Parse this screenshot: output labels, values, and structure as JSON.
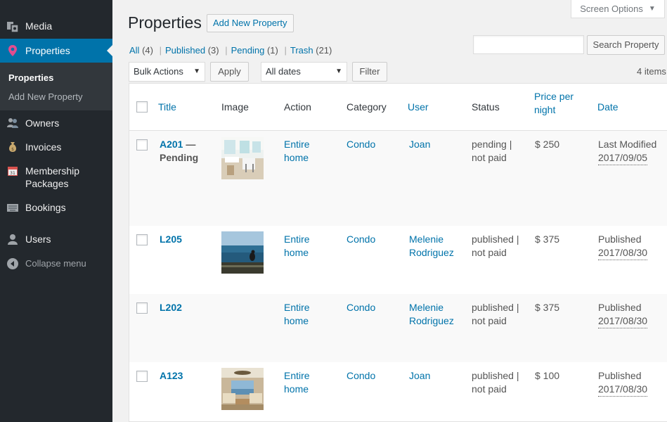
{
  "sidebar": {
    "items": [
      {
        "label": "Media",
        "icon": "media-icon"
      },
      {
        "label": "Properties",
        "icon": "pin-icon",
        "active": true
      },
      {
        "label": "Owners",
        "icon": "owners-icon"
      },
      {
        "label": "Invoices",
        "icon": "money-bag-icon"
      },
      {
        "label": "Membership Packages",
        "icon": "calendar-icon"
      },
      {
        "label": "Bookings",
        "icon": "keyboard-icon"
      },
      {
        "label": "Users",
        "icon": "user-icon"
      }
    ],
    "submenu": [
      "Properties",
      "Add New Property"
    ],
    "collapse": "Collapse menu"
  },
  "header": {
    "screen_options": "Screen Options",
    "title": "Properties",
    "add_new": "Add New Property"
  },
  "views": {
    "all": "All",
    "all_count": "(4)",
    "published": "Published",
    "published_count": "(3)",
    "pending": "Pending",
    "pending_count": "(1)",
    "trash": "Trash",
    "trash_count": "(21)",
    "separator": "|"
  },
  "search": {
    "value": "",
    "button": "Search Property"
  },
  "toolbar": {
    "bulk_actions": "Bulk Actions",
    "apply": "Apply",
    "dates": "All dates",
    "filter": "Filter",
    "items_count": "4 items"
  },
  "table": {
    "columns": [
      "Title",
      "Image",
      "Action",
      "Category",
      "User",
      "Status",
      "Price per night",
      "Date"
    ],
    "rows": [
      {
        "title": "A201",
        "state": " — Pending",
        "action": "Entire home",
        "category": "Condo",
        "user": "Joan",
        "status": "pending | not paid",
        "price": "$ 250",
        "date_label": "Last Modified",
        "date": "2017/09/05",
        "image": "kitchen"
      },
      {
        "title": "L205",
        "state": "",
        "action": "Entire home",
        "category": "Condo",
        "user": "Melenie Rodriguez",
        "status": "published | not paid",
        "price": "$ 375",
        "date_label": "Published",
        "date": "2017/08/30",
        "image": "ocean-bird"
      },
      {
        "title": "L202",
        "state": "",
        "action": "Entire home",
        "category": "Condo",
        "user": "Melenie Rodriguez",
        "status": "published | not paid",
        "price": "$ 375",
        "date_label": "Published",
        "date": "2017/08/30",
        "image": ""
      },
      {
        "title": "A123",
        "state": "",
        "action": "Entire home",
        "category": "Condo",
        "user": "Joan",
        "status": "published | not paid",
        "price": "$ 100",
        "date_label": "Published",
        "date": "2017/08/30",
        "image": "living-room"
      }
    ]
  },
  "colors": {
    "sidebar": "#23282d",
    "accent": "#0073aa",
    "background": "#f1f1f1"
  }
}
